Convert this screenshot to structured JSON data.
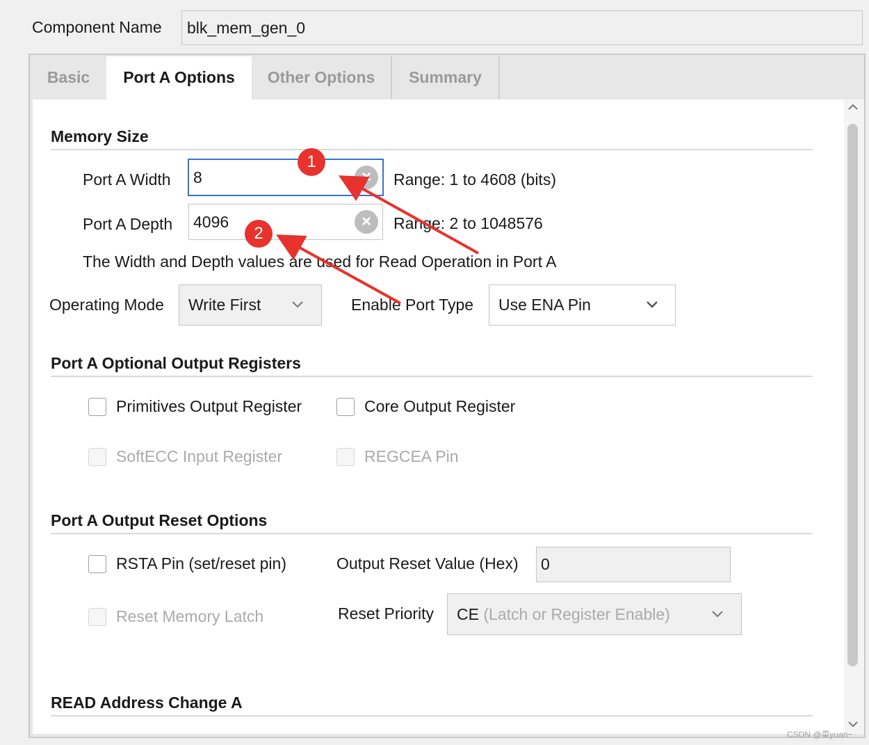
{
  "component": {
    "label": "Component Name",
    "value": "blk_mem_gen_0"
  },
  "tabs": [
    {
      "label": "Basic"
    },
    {
      "label": "Port A Options"
    },
    {
      "label": "Other Options"
    },
    {
      "label": "Summary"
    }
  ],
  "memory_size": {
    "title": "Memory Size",
    "width_label": "Port A Width",
    "width_value": "8",
    "width_range": "Range: 1 to 4608 (bits)",
    "depth_label": "Port A Depth",
    "depth_value": "4096",
    "depth_range": "Range: 2 to 1048576",
    "note": "The Width and Depth values are used for Read Operation in Port A"
  },
  "operating_mode": {
    "label": "Operating Mode",
    "value": "Write First"
  },
  "enable_port_type": {
    "label": "Enable Port Type",
    "value": "Use ENA Pin"
  },
  "optional_output_registers": {
    "title": "Port A Optional Output Registers",
    "primitives": "Primitives Output Register",
    "core": "Core Output Register",
    "softecc": "SoftECC Input Register",
    "regcea": "REGCEA Pin"
  },
  "output_reset": {
    "title": "Port A Output Reset Options",
    "rsta": "RSTA Pin (set/reset pin)",
    "reset_value_label": "Output Reset Value (Hex)",
    "reset_value": "0",
    "reset_memory_latch": "Reset Memory Latch",
    "priority_label": "Reset Priority",
    "priority_value_main": "CE",
    "priority_value_detail": "(Latch or Register Enable)"
  },
  "read_address": {
    "title": "READ Address Change A"
  },
  "annotations": {
    "badge1": "1",
    "badge2": "2",
    "color": "#e8322d"
  },
  "watermark": "CSDN @菜yuan~",
  "icons": [
    "clear-icon",
    "chevron-down-icon",
    "scroll-up-icon",
    "scroll-down-icon"
  ]
}
